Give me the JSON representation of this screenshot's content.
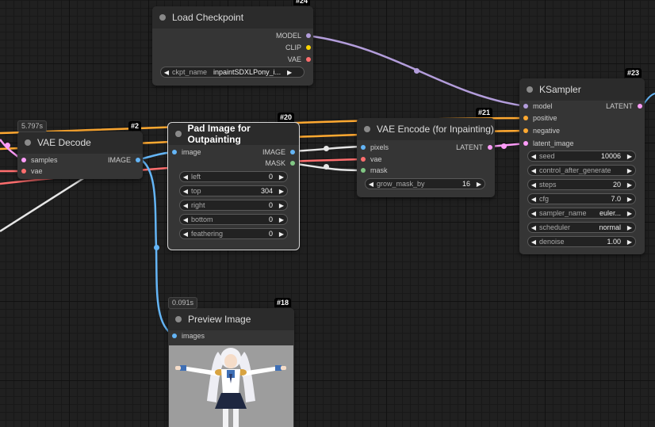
{
  "colors": {
    "model": "#b39ddb",
    "clip": "#ffd500",
    "vae": "#ff6e6e",
    "image": "#64b5f6",
    "mask": "#81c784",
    "latent": "#ff9cf9",
    "conditioning": "#ffa931",
    "white": "#e6e6e6"
  },
  "nodes": {
    "load_checkpoint": {
      "id": "#24",
      "title": "Load Checkpoint",
      "outputs": [
        "MODEL",
        "CLIP",
        "VAE"
      ],
      "widget": {
        "label": "ckpt_name",
        "value": "inpaintSDXLPony_i..."
      }
    },
    "vae_decode": {
      "id": "#2",
      "title": "VAE Decode",
      "time": "5.797s",
      "inputs": [
        "samples",
        "vae"
      ],
      "outputs": [
        "IMAGE"
      ]
    },
    "pad_image": {
      "id": "#20",
      "title": "Pad Image for Outpainting",
      "inputs": [
        "image"
      ],
      "outputs": [
        "IMAGE",
        "MASK"
      ],
      "widgets": [
        {
          "label": "left",
          "value": "0"
        },
        {
          "label": "top",
          "value": "304"
        },
        {
          "label": "right",
          "value": "0"
        },
        {
          "label": "bottom",
          "value": "0"
        },
        {
          "label": "feathering",
          "value": "0"
        }
      ]
    },
    "vae_encode": {
      "id": "#21",
      "title": "VAE Encode (for Inpainting)",
      "inputs": [
        "pixels",
        "vae",
        "mask"
      ],
      "outputs": [
        "LATENT"
      ],
      "widget": {
        "label": "grow_mask_by",
        "value": "16"
      }
    },
    "ksampler": {
      "id": "#23",
      "title": "KSampler",
      "inputs": [
        "model",
        "positive",
        "negative",
        "latent_image"
      ],
      "outputs": [
        "LATENT"
      ],
      "widgets": [
        {
          "label": "seed",
          "value": "10006"
        },
        {
          "label": "control_after_generate",
          "value": "fixed"
        },
        {
          "label": "steps",
          "value": "20"
        },
        {
          "label": "cfg",
          "value": "7.0"
        },
        {
          "label": "sampler_name",
          "value": "euler..."
        },
        {
          "label": "scheduler",
          "value": "normal"
        },
        {
          "label": "denoise",
          "value": "1.00"
        }
      ]
    },
    "preview_image": {
      "id": "#18",
      "title": "Preview Image",
      "time": "0.091s",
      "inputs": [
        "images"
      ]
    }
  }
}
